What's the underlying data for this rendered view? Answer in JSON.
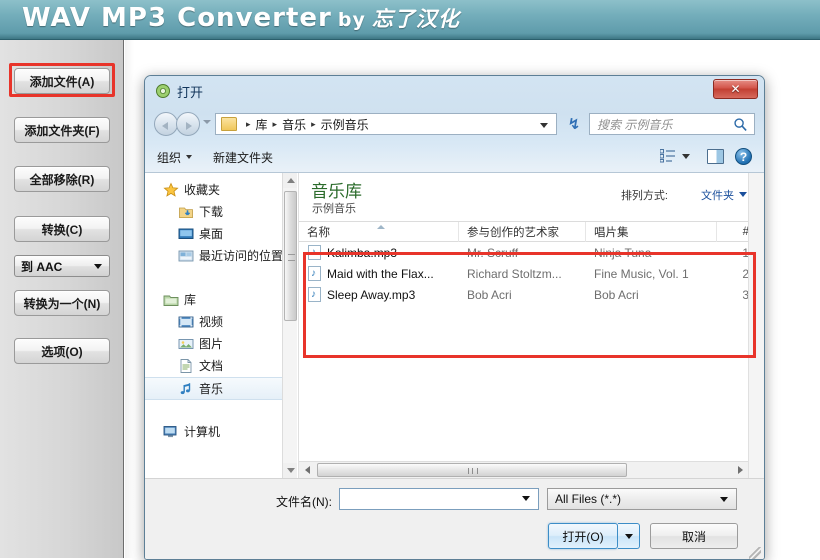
{
  "app": {
    "title_main": "WAV MP3 Converter",
    "title_by": "by",
    "title_cn": "忘了汉化",
    "accent_color": "#6aa8b5",
    "highlight_color": "#e8342a"
  },
  "sidebar": {
    "buttons": [
      {
        "label": "添加文件(A)",
        "name": "add-file",
        "highlighted": true
      },
      {
        "label": "添加文件夹(F)",
        "name": "add-folder"
      },
      {
        "label": "全部移除(R)",
        "name": "remove-all"
      },
      {
        "label": "转换(C)",
        "name": "convert"
      }
    ],
    "format_select": {
      "label": "到  AAC",
      "options": [
        "到  AAC"
      ]
    },
    "buttons2": [
      {
        "label": "转换为一个(N)",
        "name": "convert-to-one"
      },
      {
        "label": "选项(O)",
        "name": "options"
      }
    ]
  },
  "dialog": {
    "title": "打开",
    "close_label": "✕",
    "breadcrumb": {
      "items": [
        "库",
        "音乐",
        "示例音乐"
      ],
      "separator": "▸"
    },
    "search": {
      "placeholder": "搜索 示例音乐",
      "icon": "search-icon"
    },
    "refresh_icon": "↯",
    "toolbar": {
      "organize": "组织",
      "new_folder": "新建文件夹",
      "help_glyph": "?"
    },
    "nav_pane": {
      "items": [
        {
          "label": "收藏夹",
          "level": "root",
          "icon": "star-icon"
        },
        {
          "label": "下载",
          "level": "child",
          "icon": "download-icon"
        },
        {
          "label": "桌面",
          "level": "child",
          "icon": "desktop-icon"
        },
        {
          "label": "最近访问的位置",
          "level": "child",
          "icon": "recent-icon"
        },
        {
          "label": "库",
          "level": "root",
          "icon": "library-icon"
        },
        {
          "label": "视频",
          "level": "child",
          "icon": "video-icon"
        },
        {
          "label": "图片",
          "level": "child",
          "icon": "picture-icon"
        },
        {
          "label": "文档",
          "level": "child",
          "icon": "document-icon"
        },
        {
          "label": "音乐",
          "level": "child",
          "icon": "music-icon",
          "selected": true
        },
        {
          "label": "计算机",
          "level": "root",
          "icon": "computer-icon"
        }
      ]
    },
    "library": {
      "title": "音乐库",
      "subtitle": "示例音乐",
      "arrange_label": "排列方式:",
      "arrange_value": "文件夹"
    },
    "columns": [
      {
        "label": "名称",
        "name": "name"
      },
      {
        "label": "参与创作的艺术家",
        "name": "artist"
      },
      {
        "label": "唱片集",
        "name": "album"
      },
      {
        "label": "#",
        "name": "track"
      }
    ],
    "files": [
      {
        "name": "Kalimba.mp3",
        "artist": "Mr. Scruff",
        "album": "Ninja Tuna",
        "track": "1"
      },
      {
        "name": "Maid with the Flax...",
        "artist": "Richard Stoltzm...",
        "album": "Fine Music, Vol. 1",
        "track": "2"
      },
      {
        "name": "Sleep Away.mp3",
        "artist": "Bob Acri",
        "album": "Bob Acri",
        "track": "3"
      }
    ],
    "footer": {
      "filename_label": "文件名(N):",
      "filename_value": "",
      "filename_placeholder": "",
      "filetype_value": "All Files (*.*)",
      "open_label": "打开(O)",
      "cancel_label": "取消"
    }
  }
}
